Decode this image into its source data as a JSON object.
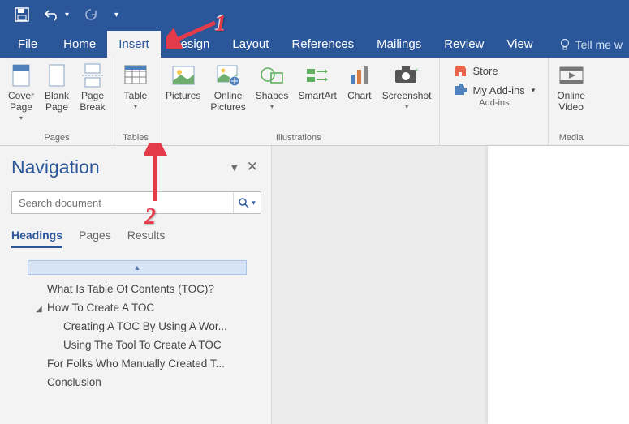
{
  "qat": {
    "save": "save",
    "undo": "undo",
    "redo": "redo"
  },
  "tabs": {
    "file": "File",
    "home": "Home",
    "insert": "Insert",
    "design": "Design",
    "layout": "Layout",
    "references": "References",
    "mailings": "Mailings",
    "review": "Review",
    "view": "View",
    "tell": "Tell me w"
  },
  "ribbon": {
    "pages": {
      "label": "Pages",
      "cover": "Cover\nPage",
      "blank": "Blank\nPage",
      "break": "Page\nBreak"
    },
    "tables": {
      "label": "Tables",
      "table": "Table"
    },
    "illus": {
      "label": "Illustrations",
      "pictures": "Pictures",
      "online": "Online\nPictures",
      "shapes": "Shapes",
      "smartart": "SmartArt",
      "chart": "Chart",
      "screenshot": "Screenshot"
    },
    "addins": {
      "label": "Add-ins",
      "store": "Store",
      "myaddins": "My Add-ins"
    },
    "media": {
      "label": "Media",
      "video": "Online\nVideo"
    }
  },
  "nav": {
    "title": "Navigation",
    "search_placeholder": "Search document",
    "tabs": {
      "headings": "Headings",
      "pages": "Pages",
      "results": "Results"
    },
    "tree": [
      {
        "level": 1,
        "text": "What Is Table Of Contents (TOC)?"
      },
      {
        "level": 1,
        "text": "How To Create A TOC",
        "expanded": true
      },
      {
        "level": 2,
        "text": "Creating A TOC By Using A Wor..."
      },
      {
        "level": 2,
        "text": "Using The Tool To Create A TOC"
      },
      {
        "level": 1,
        "text": "For Folks Who Manually Created T..."
      },
      {
        "level": 1,
        "text": "Conclusion"
      }
    ]
  },
  "callouts": {
    "one": "1",
    "two": "2"
  }
}
